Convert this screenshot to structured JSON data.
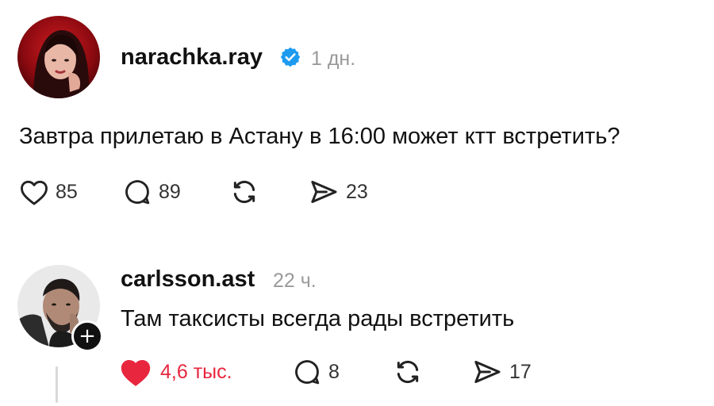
{
  "post": {
    "username": "narachka.ray",
    "verified": true,
    "time": "1 дн.",
    "text": "Завтра прилетаю в Астану в 16:00 может ктт встретить?",
    "actions": {
      "likes": "85",
      "comments": "89",
      "shares": "23"
    }
  },
  "reply": {
    "username": "carlsson.ast",
    "time": "22 ч.",
    "text": "Там таксисты всегда рады встретить",
    "follow_glyph": "+",
    "actions": {
      "liked": true,
      "likes": "4,6 тыс.",
      "comments": "8",
      "shares": "17"
    }
  },
  "colors": {
    "verified": "#1d9bf0",
    "liked": "#e8263e",
    "muted": "#9a9a9a"
  }
}
